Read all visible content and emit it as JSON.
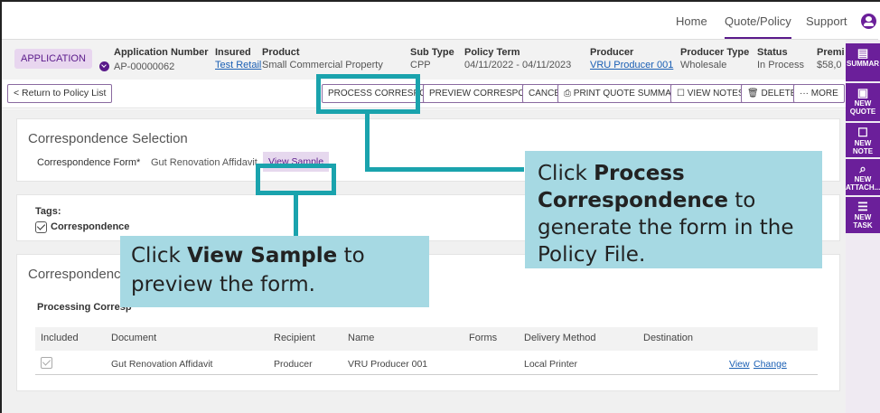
{
  "nav": {
    "home": "Home",
    "quote_policy": "Quote/Policy",
    "support": "Support"
  },
  "info": {
    "badge": "APPLICATION",
    "app_number_label": "Application Number",
    "app_number": "AP-00000062",
    "insured_label": "Insured",
    "insured": "Test Retail",
    "product_label": "Product",
    "product": "Small Commercial Property",
    "subtype_label": "Sub Type",
    "subtype": "CPP",
    "term_label": "Policy Term",
    "term": "04/11/2022 - 04/11/2023",
    "producer_label": "Producer",
    "producer": "VRU Producer 001",
    "producer_type_label": "Producer Type",
    "producer_type": "Wholesale",
    "status_label": "Status",
    "status": "In Process",
    "premium_label": "Premi",
    "premium": "$58,0"
  },
  "actions": {
    "return": "< Return to Policy List",
    "process": "PROCESS CORRESPON...",
    "preview": "PREVIEW CORRESPON...",
    "cancel": "CANCEL",
    "print": "PRINT QUOTE SUMMA...",
    "notes": "VIEW NOTES",
    "delete": "DELETE",
    "more": "··· MORE"
  },
  "sidebar": {
    "summary": "SUMMAR",
    "quote": [
      "NEW",
      "QUOTE"
    ],
    "note": [
      "NEW",
      "NOTE"
    ],
    "attach": [
      "NEW",
      "ATTACH..."
    ],
    "task": [
      "NEW",
      "TASK"
    ]
  },
  "selection": {
    "title": "Correspondence Selection",
    "form_label": "Correspondence Form*",
    "form_value": "Gut Renovation Affidavit",
    "view_sample": "View Sample"
  },
  "tags": {
    "label": "Tags:",
    "item": "Correspondence"
  },
  "corr": {
    "title": "Correspondence",
    "subtitle": "Processing Corresp",
    "headers": [
      "Included",
      "Document",
      "Recipient",
      "Name",
      "Forms",
      "Delivery Method",
      "Destination"
    ],
    "row": {
      "document": "Gut Renovation Affidavit",
      "recipient": "Producer",
      "name": "VRU Producer 001",
      "forms": "",
      "delivery": "Local Printer",
      "destination": "",
      "view": "View",
      "change": "Change"
    }
  },
  "callouts": {
    "process_pre": "Click ",
    "process_bold": "Process Correspondence",
    "process_post": " to generate the form in the Policy File.",
    "sample_pre": "Click ",
    "sample_bold": "View Sample",
    "sample_post": " to preview the form."
  },
  "colors": {
    "brand": "#6b1f9a",
    "callout_border": "#1aa3ad",
    "callout_fill": "#a6d9e3"
  }
}
